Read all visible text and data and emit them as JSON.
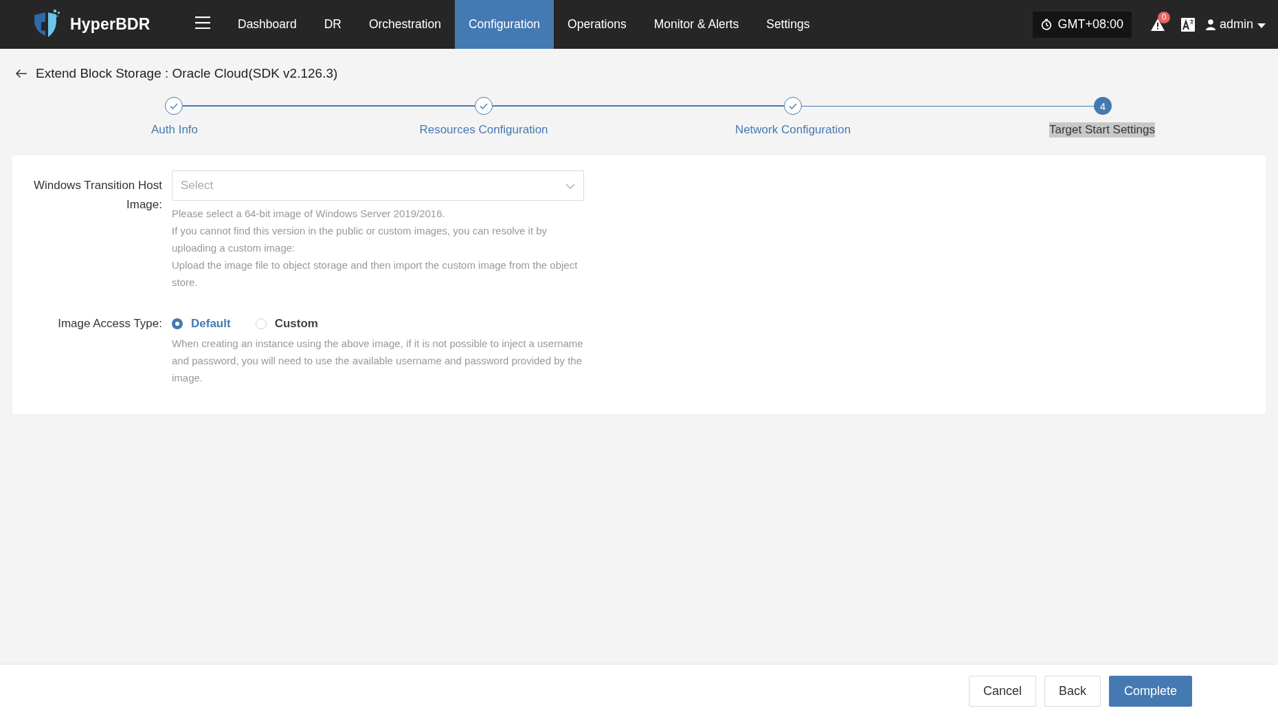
{
  "header": {
    "brand": "HyperBDR",
    "nav": [
      {
        "label": "Dashboard",
        "selected": false
      },
      {
        "label": "DR",
        "selected": false
      },
      {
        "label": "Orchestration",
        "selected": false
      },
      {
        "label": "Configuration",
        "selected": true
      },
      {
        "label": "Operations",
        "selected": false
      },
      {
        "label": "Monitor & Alerts",
        "selected": false
      },
      {
        "label": "Settings",
        "selected": false
      }
    ],
    "timezone": "GMT+08:00",
    "alert_count": "0",
    "user": "admin"
  },
  "page_title": "Extend Block Storage : Oracle Cloud(SDK v2.126.3)",
  "steps": [
    {
      "label": "Auth Info",
      "completed": true
    },
    {
      "label": "Resources Configuration",
      "completed": true
    },
    {
      "label": "Network Configuration",
      "completed": true
    },
    {
      "label": "Target Start Settings",
      "completed": false,
      "number": "4"
    }
  ],
  "form": {
    "fields": [
      {
        "kind": "select",
        "label": "Windows Transition Host Image:",
        "placeholder": "Select",
        "hints": [
          "Please select a 64-bit image of Windows Server 2019/2016.",
          "If you cannot find this version in the public or custom images, you can resolve it by uploading a custom image:",
          "Upload the image file to object storage and then import the custom image from the object store."
        ]
      },
      {
        "kind": "radio",
        "label": "Image Access Type:",
        "options": [
          {
            "label": "Default",
            "selected": true
          },
          {
            "label": "Custom",
            "selected": false
          }
        ],
        "hints": [
          "When creating an instance using the above image, if it is not possible to inject a username and password, you will need to use the available username and password provided by the image."
        ]
      }
    ]
  },
  "footer": {
    "buttons": [
      {
        "label": "Cancel",
        "kind": "default"
      },
      {
        "label": "Back",
        "kind": "default"
      },
      {
        "label": "Complete",
        "kind": "primary"
      }
    ]
  }
}
